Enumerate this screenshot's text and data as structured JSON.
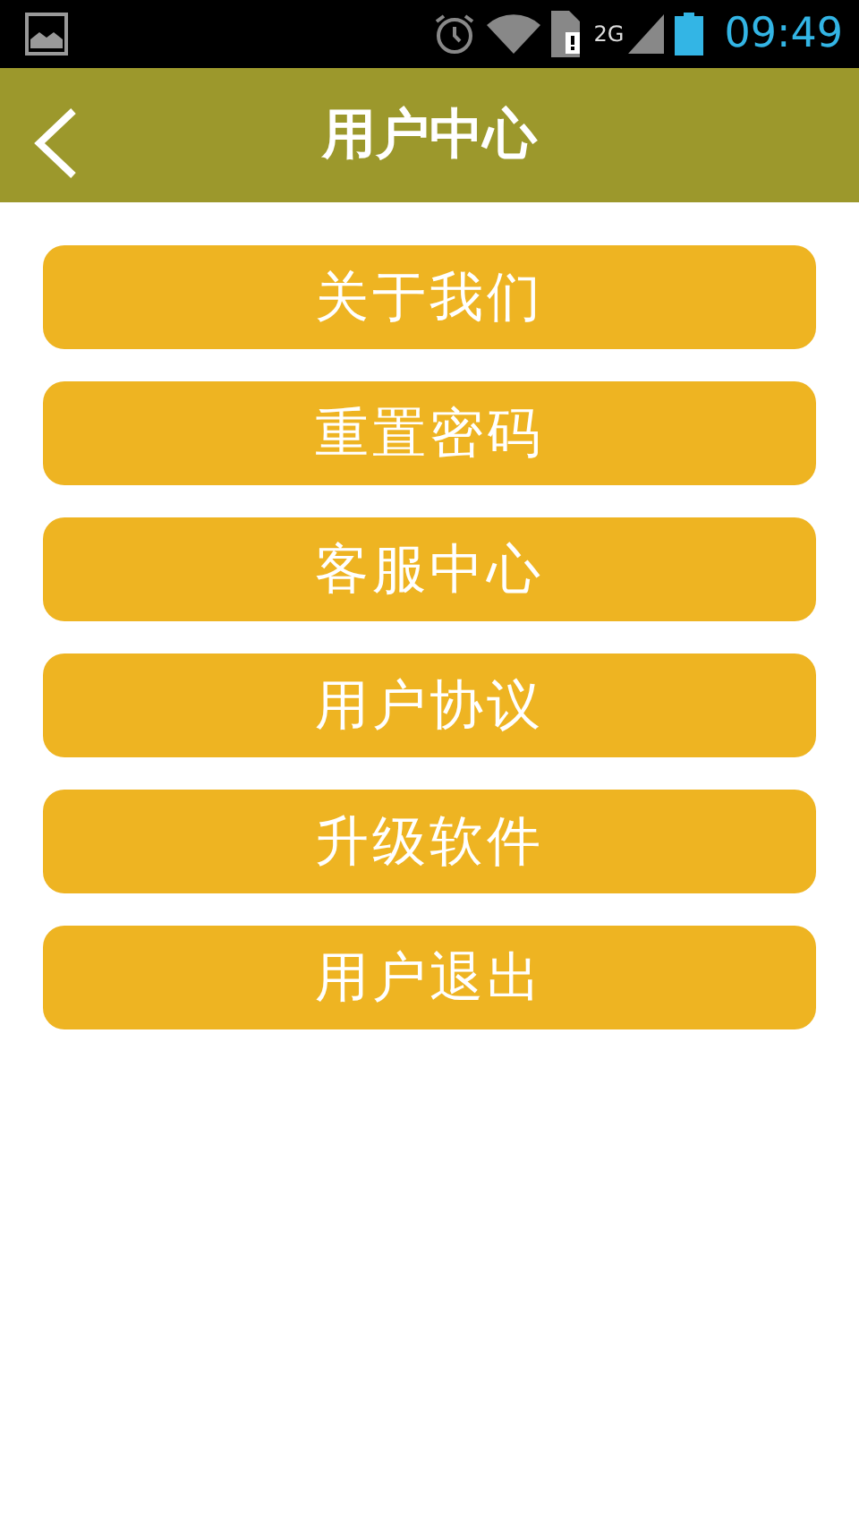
{
  "status_bar": {
    "network": "2G",
    "time": "09:49"
  },
  "header": {
    "title": "用户中心"
  },
  "menu": [
    {
      "label": "关于我们"
    },
    {
      "label": "重置密码"
    },
    {
      "label": "客服中心"
    },
    {
      "label": "用户协议"
    },
    {
      "label": "升级软件"
    },
    {
      "label": "用户退出"
    }
  ]
}
